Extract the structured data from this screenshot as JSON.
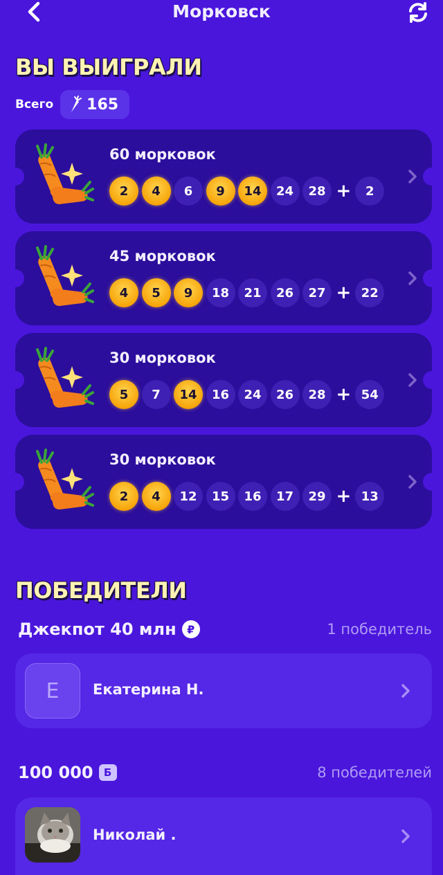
{
  "header": {
    "title": "Морковск"
  },
  "won_section": {
    "title": "ВЫ ВЫИГРАЛИ",
    "total_label": "Всего",
    "total_value": "165"
  },
  "tickets": [
    {
      "prize": "60 морковок",
      "numbers": [
        "2",
        "4",
        "6",
        "9",
        "14",
        "24",
        "28"
      ],
      "hits": [
        true,
        true,
        false,
        true,
        true,
        false,
        false
      ],
      "bonus": "2"
    },
    {
      "prize": "45 морковок",
      "numbers": [
        "4",
        "5",
        "9",
        "18",
        "21",
        "26",
        "27"
      ],
      "hits": [
        true,
        true,
        true,
        false,
        false,
        false,
        false
      ],
      "bonus": "22"
    },
    {
      "prize": "30 морковок",
      "numbers": [
        "5",
        "7",
        "14",
        "16",
        "24",
        "26",
        "28"
      ],
      "hits": [
        true,
        false,
        true,
        false,
        false,
        false,
        false
      ],
      "bonus": "54"
    },
    {
      "prize": "30 морковок",
      "numbers": [
        "2",
        "4",
        "12",
        "15",
        "16",
        "17",
        "29"
      ],
      "hits": [
        true,
        true,
        false,
        false,
        false,
        false,
        false
      ],
      "bonus": "13"
    }
  ],
  "winners_section": {
    "title": "ПОБЕДИТЕЛИ",
    "groups": [
      {
        "name": "Джекпот 40 млн",
        "currency_symbol": "₽",
        "count": "1 победитель",
        "winners": [
          {
            "initial": "Е",
            "name": "Екатерина Н."
          }
        ]
      },
      {
        "name": "100 000",
        "currency_symbol": "Б",
        "count": "8 победителей",
        "winners": [
          {
            "name": "Николай ."
          }
        ]
      }
    ]
  },
  "colors": {
    "background": "#4a16dc",
    "ticket": "#2b0e9c",
    "ball_hit": "#f7a50a",
    "ball": "#3f20b4",
    "section_title": "#fff2b3"
  }
}
